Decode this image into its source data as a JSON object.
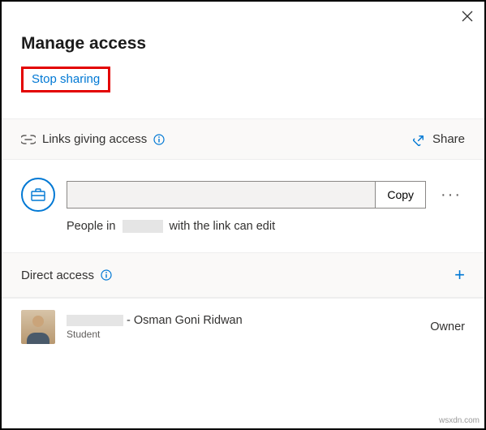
{
  "header": {
    "title": "Manage access",
    "stop_sharing_label": "Stop sharing"
  },
  "links_section": {
    "label": "Links giving access",
    "share_label": "Share",
    "link_value": "",
    "copy_label": "Copy",
    "description_prefix": "People in",
    "description_org": "",
    "description_suffix": "with the link can edit"
  },
  "direct_section": {
    "label": "Direct access",
    "people": [
      {
        "name_prefix": "",
        "name_separator": "-",
        "name": "Osman Goni Ridwan",
        "role": "Student",
        "permission": "Owner"
      }
    ]
  },
  "watermark": "wsxdn.com"
}
